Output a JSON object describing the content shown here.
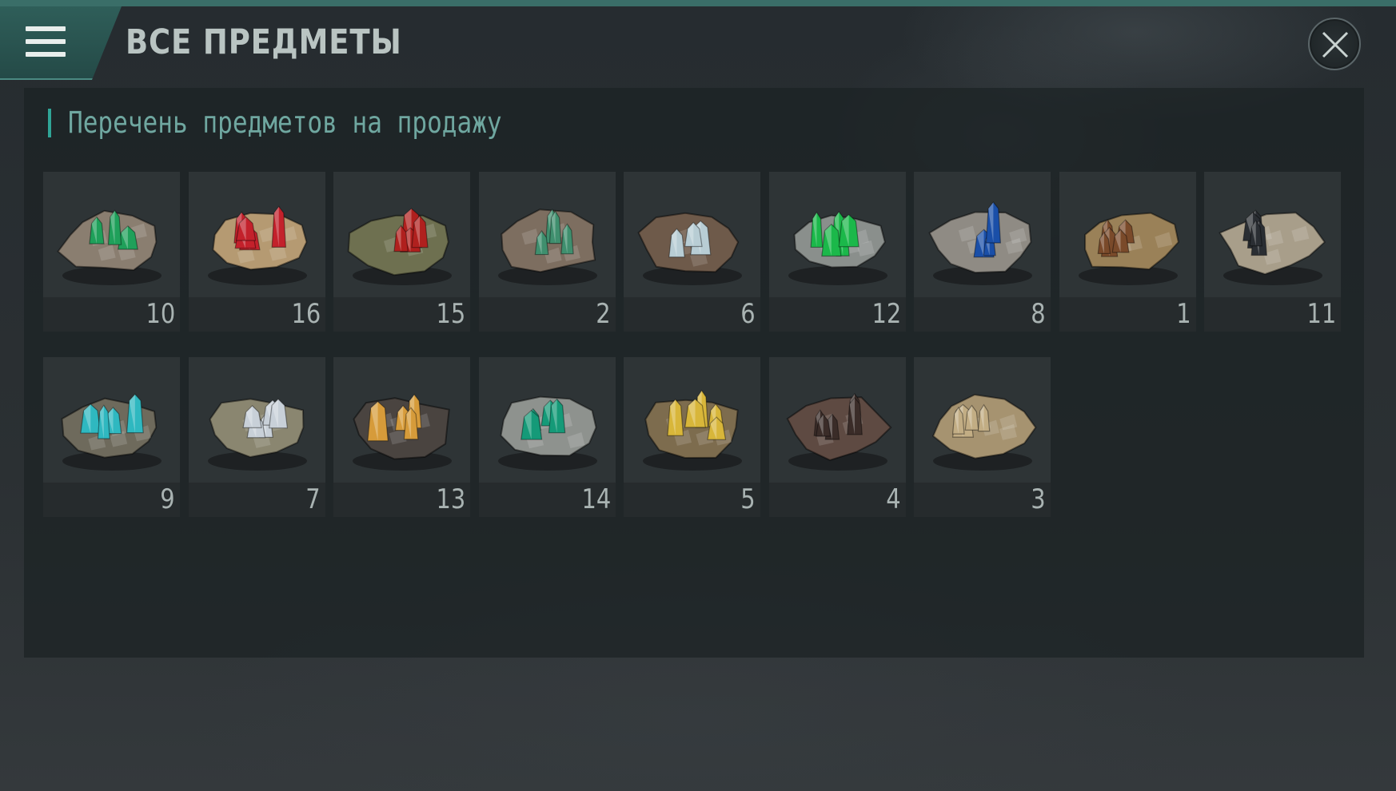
{
  "header": {
    "title": "ВСЕ ПРЕДМЕТЫ"
  },
  "section": {
    "title": "Перечень предметов на продажу"
  },
  "items": [
    {
      "name": "green-crystal-ore",
      "count": "10",
      "rock": "#8a7e70",
      "crystal": "#1fa05a"
    },
    {
      "name": "red-crystal-ore",
      "count": "16",
      "rock": "#b59a72",
      "crystal": "#c3212b"
    },
    {
      "name": "ruby-olive-ore",
      "count": "15",
      "rock": "#6e7050",
      "crystal": "#b0201e"
    },
    {
      "name": "brown-rock-ore",
      "count": "2",
      "rock": "#7d6e60",
      "crystal": "#3f8f6e"
    },
    {
      "name": "clear-quartz-ore",
      "count": "6",
      "rock": "#6e5a4a",
      "crystal": "#b8cdd4"
    },
    {
      "name": "grey-emerald-ore",
      "count": "12",
      "rock": "#8a8f8c",
      "crystal": "#1bb84a"
    },
    {
      "name": "blue-sapphire-ore",
      "count": "8",
      "rock": "#8f8b84",
      "crystal": "#1a4fa8"
    },
    {
      "name": "rust-nugget-ore",
      "count": "1",
      "rock": "#9a8158",
      "crystal": "#7a4a2a"
    },
    {
      "name": "black-prism-ore",
      "count": "11",
      "rock": "#a89e8a",
      "crystal": "#2a2e33"
    },
    {
      "name": "cyan-crystal-ore",
      "count": "9",
      "rock": "#6e6a5c",
      "crystal": "#2fb8c0"
    },
    {
      "name": "silver-crystal-ore",
      "count": "7",
      "rock": "#8a8670",
      "crystal": "#c8d0d8"
    },
    {
      "name": "amber-crystal-ore",
      "count": "13",
      "rock": "#4a4440",
      "crystal": "#d69b3a"
    },
    {
      "name": "teal-stone-ore",
      "count": "14",
      "rock": "#8e928e",
      "crystal": "#159a78"
    },
    {
      "name": "gold-vein-ore",
      "count": "5",
      "rock": "#7d6c4e",
      "crystal": "#d8b63a"
    },
    {
      "name": "dark-ingot-ore",
      "count": "4",
      "rock": "#5e4a42",
      "crystal": "#3a2c28"
    },
    {
      "name": "sandstone-ore",
      "count": "3",
      "rock": "#a69370",
      "crystal": "#c2ad84"
    }
  ]
}
